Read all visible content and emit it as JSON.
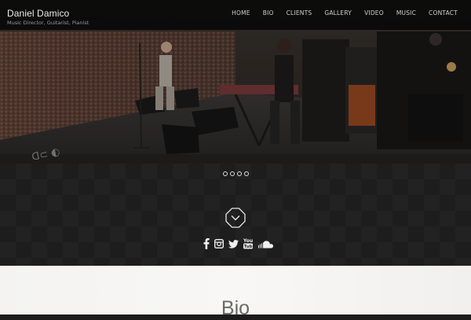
{
  "header": {
    "site_name": "Daniel Damico",
    "tagline": "Music Director, Guitarist, Pianist"
  },
  "nav": {
    "items": [
      {
        "label": "HOME"
      },
      {
        "label": "BIO"
      },
      {
        "label": "CLIENTS"
      },
      {
        "label": "GALLERY"
      },
      {
        "label": "VIDEO"
      },
      {
        "label": "MUSIC"
      },
      {
        "label": "CONTACT"
      }
    ]
  },
  "slider": {
    "slide_count": 4,
    "active_index": 0
  },
  "scroll_button": {
    "icon": "chevron-down-icon"
  },
  "social": {
    "icons": [
      "facebook-icon",
      "instagram-icon",
      "twitter-icon",
      "youtube-icon",
      "soundcloud-icon"
    ]
  },
  "bio": {
    "title": "Bio"
  }
}
